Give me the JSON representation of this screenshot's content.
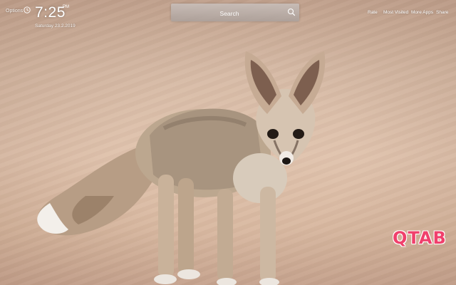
{
  "header": {
    "options_label": "Options",
    "time": "7:25",
    "ampm": "PM",
    "date": "Saturday 23.2.2019"
  },
  "search": {
    "placeholder": "Search"
  },
  "nav": {
    "rate": "Rate",
    "most_visited": "Most Visited",
    "more_apps": "More Apps",
    "share": "Share"
  },
  "brand": {
    "logo_text": "QTAB",
    "logo_color": "#f0406c"
  },
  "icons": [
    "clock-icon",
    "search-icon"
  ],
  "background": {
    "subject": "fennec-fox-on-sand",
    "sand_color": "#d9bca7"
  }
}
